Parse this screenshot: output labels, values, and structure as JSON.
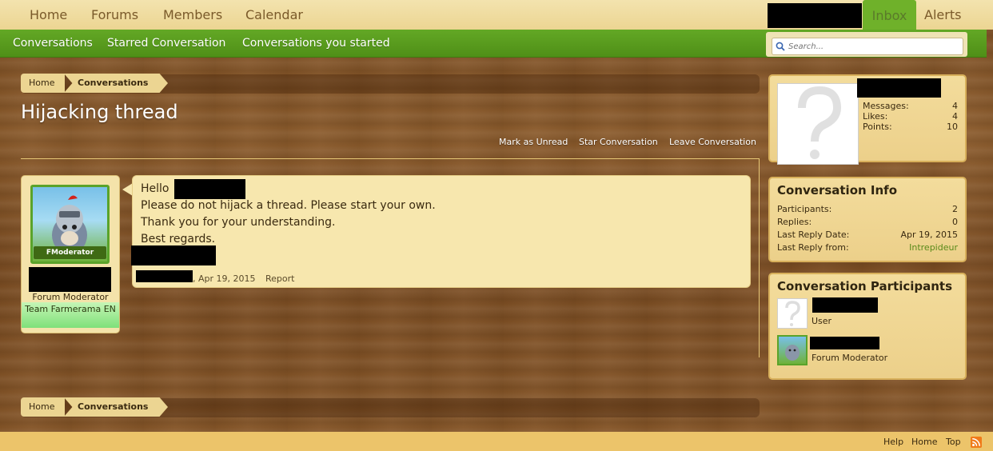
{
  "nav": {
    "home": "Home",
    "forums": "Forums",
    "members": "Members",
    "calendar": "Calendar",
    "inbox": "Inbox",
    "alerts": "Alerts"
  },
  "subnav": {
    "conversations": "Conversations",
    "starred": "Starred Conversation",
    "started": "Conversations you started"
  },
  "search": {
    "placeholder": "Search..."
  },
  "breadcrumb": {
    "home": "Home",
    "conversations": "Conversations"
  },
  "page": {
    "title": "Hijacking thread"
  },
  "actions": {
    "mark_unread": "Mark as Unread",
    "star": "Star Conversation",
    "leave": "Leave Conversation"
  },
  "message": {
    "greeting": "Hello",
    "line2": "Please do not hijack a thread. Please start your own.",
    "line3": "Thank you for your understanding.",
    "line4": "Best regards.",
    "date": ", Apr 19, 2015",
    "report": "Report",
    "author_title": "Forum Moderator",
    "author_team": "Team Farmerama EN",
    "avatar_badge": "FModerator"
  },
  "profile": {
    "messages_label": "Messages:",
    "messages": "4",
    "likes_label": "Likes:",
    "likes": "4",
    "points_label": "Points:",
    "points": "10"
  },
  "info": {
    "heading": "Conversation Info",
    "participants_label": "Participants:",
    "participants": "2",
    "replies_label": "Replies:",
    "replies": "0",
    "last_date_label": "Last Reply Date:",
    "last_date": "Apr 19, 2015",
    "last_from_label": "Last Reply from:",
    "last_from": "Intrepideur"
  },
  "participants": {
    "heading": "Conversation Participants",
    "p1_role": "User",
    "p2_role": "Forum Moderator"
  },
  "footer": {
    "help": "Help",
    "home": "Home",
    "top": "Top"
  },
  "colors": {
    "nav_green": "#5a9e20",
    "wood": "#7c4e23",
    "panel": "#f7e7ae",
    "link_green": "#5a8a1a"
  }
}
